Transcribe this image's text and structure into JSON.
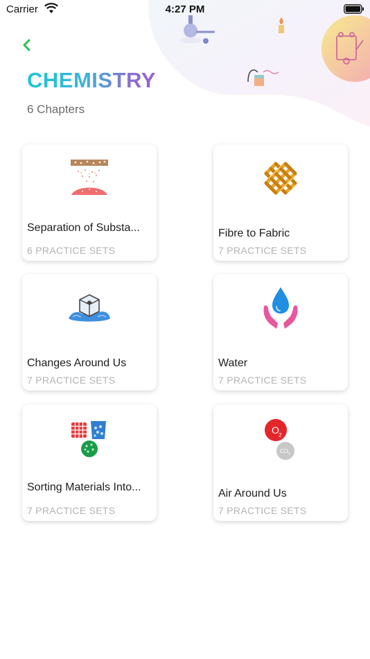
{
  "status_bar": {
    "carrier": "Carrier",
    "time": "4:27 PM"
  },
  "header": {
    "title": "CHEMISTRY",
    "subtitle": "6 Chapters"
  },
  "chapters": [
    {
      "name": "Separation of Substa...",
      "sets": "6 PRACTICE SETS",
      "icon": "sieve-icon"
    },
    {
      "name": "Fibre to Fabric",
      "sets": "7 PRACTICE SETS",
      "icon": "woven-fabric-icon"
    },
    {
      "name": "Changes Around Us",
      "sets": "7 PRACTICE SETS",
      "icon": "ice-cube-icon"
    },
    {
      "name": "Water",
      "sets": "7 PRACTICE SETS",
      "icon": "water-drop-hands-icon"
    },
    {
      "name": "Sorting Materials Into...",
      "sets": "7 PRACTICE SETS",
      "icon": "materials-beaker-icon"
    },
    {
      "name": "Air Around Us",
      "sets": "7 PRACTICE SETS",
      "icon": "o2-co2-icon"
    }
  ],
  "colors": {
    "accent_green": "#2ebd4e",
    "title_start": "#1cc8d2",
    "title_end": "#9b5fcf"
  }
}
